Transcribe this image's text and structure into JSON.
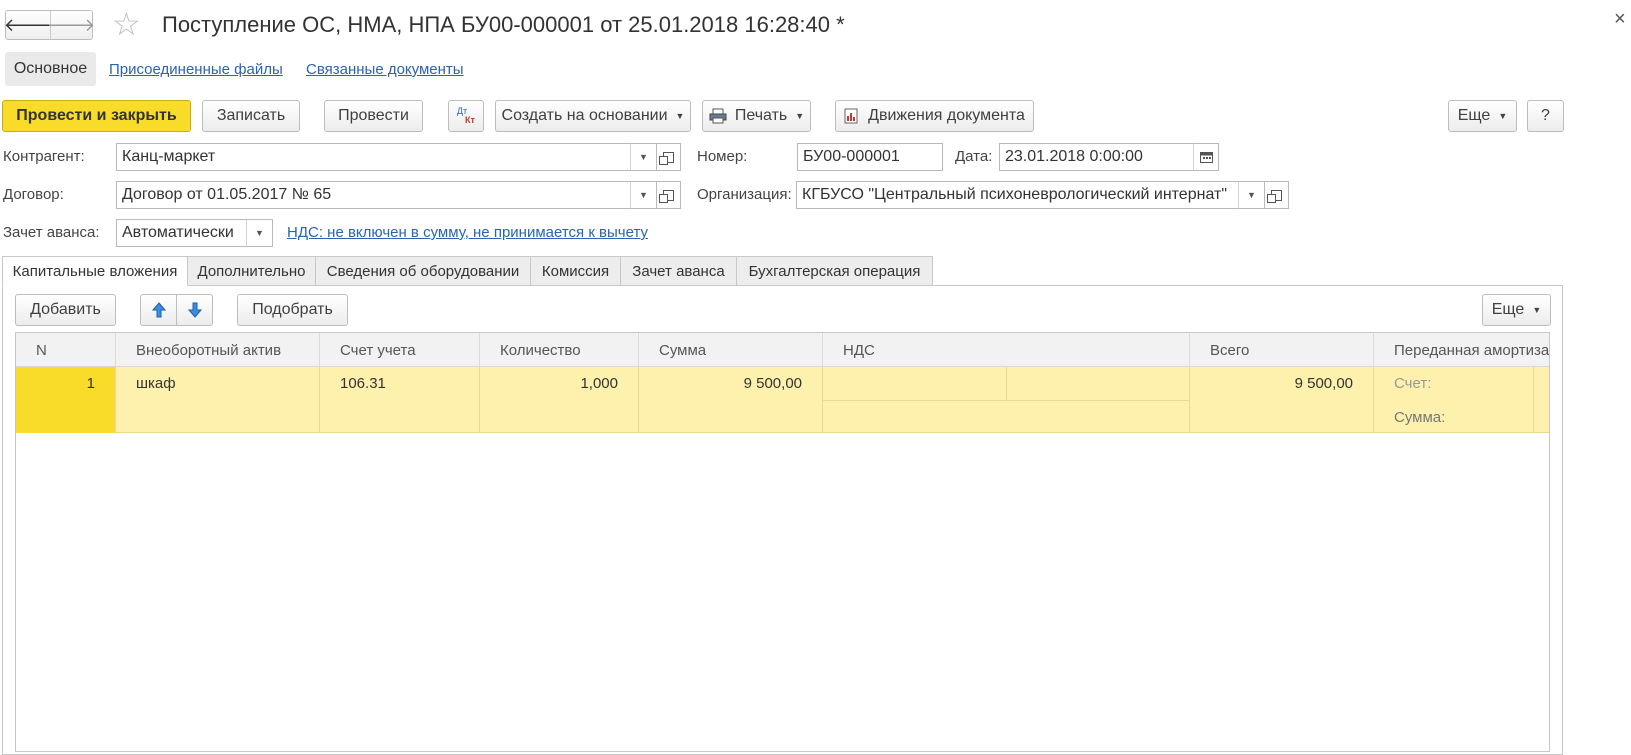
{
  "window": {
    "title": "Поступление ОС, НМА, НПА БУ00-000001 от 25.01.2018 16:28:40 *",
    "close_glyph": "×"
  },
  "nav": {
    "back": "🡐",
    "forward": "🡒",
    "favorite": "☆"
  },
  "sections": {
    "main": "Основное",
    "files": "Присоединенные файлы",
    "related": "Связанные документы"
  },
  "toolbar": {
    "post_close": "Провести и закрыть",
    "save": "Записать",
    "post": "Провести",
    "dtkt_top": "Дт",
    "dtkt_bottom": "Кт",
    "create_based": "Создать на основании",
    "print": "Печать",
    "movements": "Движения документа",
    "more": "Еще",
    "help": "?"
  },
  "form": {
    "counterparty_label": "Контрагент:",
    "counterparty_value": "Канц-маркет",
    "number_label": "Номер:",
    "number_value": "БУ00-000001",
    "date_label": "Дата:",
    "date_value": "23.01.2018  0:00:00",
    "contract_label": "Договор:",
    "contract_value": "Договор от 01.05.2017 № 65",
    "org_label": "Организация:",
    "org_value": "КГБУСО \"Центральный психоневрологический интернат\"",
    "advance_label": "Зачет аванса:",
    "advance_value": "Автоматически",
    "vat_link": "НДС: не включен в сумму, не принимается к вычету"
  },
  "tabs": [
    {
      "label": "Капитальные вложения"
    },
    {
      "label": "Дополнительно"
    },
    {
      "label": "Сведения об оборудовании"
    },
    {
      "label": "Комиссия"
    },
    {
      "label": "Зачет аванса"
    },
    {
      "label": "Бухгалтерская операция"
    }
  ],
  "table_toolbar": {
    "add": "Добавить",
    "pick": "Подобрать",
    "more": "Еще"
  },
  "table": {
    "columns": [
      "N",
      "Внеоборотный актив",
      "Счет учета",
      "Количество",
      "Сумма",
      "НДС",
      "Всего",
      "Переданная амортиза"
    ],
    "rows": [
      {
        "n": "1",
        "asset": "шкаф",
        "account": "106.31",
        "qty": "1,000",
        "sum": "9 500,00",
        "vat": "",
        "total": "9 500,00",
        "dep_account_label": "Счет:",
        "dep_sum_label": "Сумма:"
      }
    ]
  },
  "colors": {
    "accent_yellow": "#f9dc2a",
    "row_highlight": "#fdf1ad",
    "n_cell": "#f9dc2a",
    "link": "#2a63b5"
  }
}
